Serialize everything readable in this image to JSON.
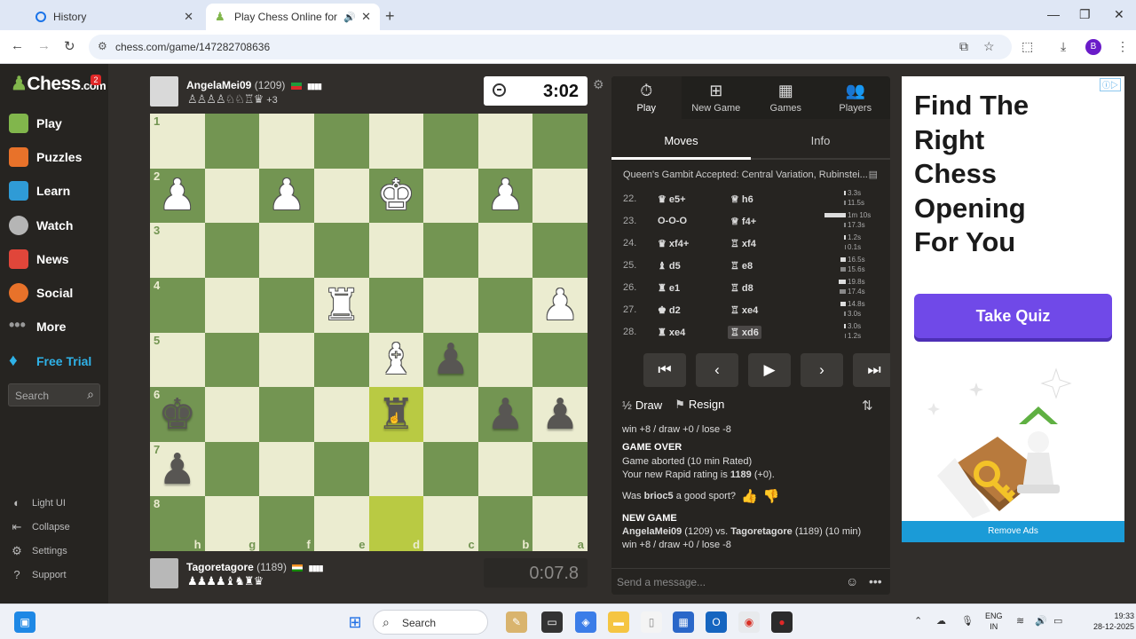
{
  "browser": {
    "tabs": [
      {
        "title": "History"
      },
      {
        "title": "Play Chess Online for FREE"
      }
    ],
    "url": "chess.com/game/147282708636"
  },
  "sidebar": {
    "logo_main": "Chess",
    "logo_com": ".com",
    "logo_badge": "2",
    "items": [
      {
        "label": "Play",
        "icon": "play-icon",
        "color": "#81b64c"
      },
      {
        "label": "Puzzles",
        "icon": "puzzle-icon",
        "color": "#e8722a"
      },
      {
        "label": "Learn",
        "icon": "learn-icon",
        "color": "#2f9bd6"
      },
      {
        "label": "Watch",
        "icon": "watch-icon",
        "color": "#b5b5b5"
      },
      {
        "label": "News",
        "icon": "news-icon",
        "color": "#e0463a"
      },
      {
        "label": "Social",
        "icon": "social-icon",
        "color": "#e8722a"
      },
      {
        "label": "More",
        "icon": "more-icon",
        "color": "#999999"
      },
      {
        "label": "Free Trial",
        "icon": "diamond-icon",
        "color": "#2fb2e8"
      }
    ],
    "search_placeholder": "Search",
    "bottom": [
      {
        "label": "Light UI",
        "icon": "light-ui-icon"
      },
      {
        "label": "Collapse",
        "icon": "collapse-icon"
      },
      {
        "label": "Settings",
        "icon": "settings-icon"
      },
      {
        "label": "Support",
        "icon": "support-icon"
      }
    ]
  },
  "players": {
    "top": {
      "name": "AngelaMei09",
      "rating": "(1209)",
      "captured": "♙♙♙♙♘♘♖♛",
      "advantage": "+3",
      "clock": "3:02"
    },
    "bottom": {
      "name": "Tagoretagore",
      "rating": "(1189)",
      "captured": "♟♟♟♟♝♞♜♛",
      "clock": "0:07.8"
    }
  },
  "board": {
    "ranks": [
      "1",
      "2",
      "3",
      "4",
      "5",
      "6",
      "7",
      "8"
    ],
    "files": [
      "h",
      "g",
      "f",
      "e",
      "d",
      "c",
      "b",
      "a"
    ],
    "pieces": [
      {
        "r": 1,
        "c": 0,
        "glyph": "♟",
        "color": "w"
      },
      {
        "r": 1,
        "c": 2,
        "glyph": "♟",
        "color": "w"
      },
      {
        "r": 1,
        "c": 4,
        "glyph": "♚",
        "color": "w"
      },
      {
        "r": 1,
        "c": 6,
        "glyph": "♟",
        "color": "w"
      },
      {
        "r": 3,
        "c": 3,
        "glyph": "♜",
        "color": "w"
      },
      {
        "r": 3,
        "c": 7,
        "glyph": "♟",
        "color": "w"
      },
      {
        "r": 4,
        "c": 4,
        "glyph": "♝",
        "color": "w"
      },
      {
        "r": 4,
        "c": 5,
        "glyph": "♟",
        "color": "b"
      },
      {
        "r": 5,
        "c": 0,
        "glyph": "♚",
        "color": "b"
      },
      {
        "r": 5,
        "c": 4,
        "glyph": "♜",
        "color": "b"
      },
      {
        "r": 5,
        "c": 6,
        "glyph": "♟",
        "color": "b"
      },
      {
        "r": 5,
        "c": 7,
        "glyph": "♟",
        "color": "b"
      },
      {
        "r": 6,
        "c": 0,
        "glyph": "♟",
        "color": "b"
      }
    ],
    "highlights": [
      {
        "r": 5,
        "c": 4
      },
      {
        "r": 7,
        "c": 4
      }
    ]
  },
  "panel": {
    "tabs": [
      {
        "label": "Play",
        "icon": "stopwatch-icon"
      },
      {
        "label": "New Game",
        "icon": "plus-icon"
      },
      {
        "label": "Games",
        "icon": "grid-icon"
      },
      {
        "label": "Players",
        "icon": "players-icon"
      }
    ],
    "subtabs": [
      "Moves",
      "Info"
    ],
    "opening": "Queen's Gambit Accepted: Central Variation, Rubinstei...",
    "moves": [
      {
        "n": "22.",
        "w": "♛ e5+",
        "b": "♕ h6",
        "tw": "3.3s",
        "tb": "11.5s",
        "fw": 2,
        "fb": 2
      },
      {
        "n": "23.",
        "w": "O-O-O",
        "b": "♕ f4+",
        "tw": "1m 10s",
        "tb": "17.3s",
        "fw": 24,
        "fb": 2
      },
      {
        "n": "24.",
        "w": "♛ xf4+",
        "b": "♖ xf4",
        "tw": "1.2s",
        "tb": "0.1s",
        "fw": 2,
        "fb": 1
      },
      {
        "n": "25.",
        "w": "♝ d5",
        "b": "♖ e8",
        "tw": "16.5s",
        "tb": "15.6s",
        "fw": 6,
        "fb": 6
      },
      {
        "n": "26.",
        "w": "♜ e1",
        "b": "♖ d8",
        "tw": "19.8s",
        "tb": "17.4s",
        "fw": 8,
        "fb": 7
      },
      {
        "n": "27.",
        "w": "♚ d2",
        "b": "♖ xe4",
        "tw": "14.8s",
        "tb": "3.0s",
        "fw": 6,
        "fb": 2
      },
      {
        "n": "28.",
        "w": "♜ xe4",
        "b": "♖ xd6",
        "tw": "3.0s",
        "tb": "1.2s",
        "fw": 2,
        "fb": 1
      }
    ],
    "draw": "Draw",
    "resign": "Resign",
    "log": {
      "line0": "win +8 / draw +0 / lose -8",
      "over_head": "GAME OVER",
      "over1": "Game aborted (10 min Rated)",
      "over2_pre": "Your new Rapid rating is ",
      "over2_val": "1189",
      "over2_post": " (+0).",
      "sport_pre": "Was ",
      "sport_name": "brioc5",
      "sport_post": " a good sport?",
      "new_head": "NEW GAME",
      "new1_a": "AngelaMei09",
      "new1_b": " (1209) vs. ",
      "new1_c": "Tagoretagore",
      "new1_d": " (1189) (10 min)",
      "new2": "win +8 / draw +0 / lose -8"
    },
    "message_placeholder": "Send a message..."
  },
  "ad": {
    "headline": [
      "Find The",
      "Right",
      "Chess",
      "Opening",
      "For You"
    ],
    "button": "Take Quiz",
    "remove": "Remove Ads"
  },
  "taskbar": {
    "search": "Search",
    "lang1": "ENG",
    "lang2": "IN",
    "time": "19:33",
    "date": "28-12-2025"
  }
}
